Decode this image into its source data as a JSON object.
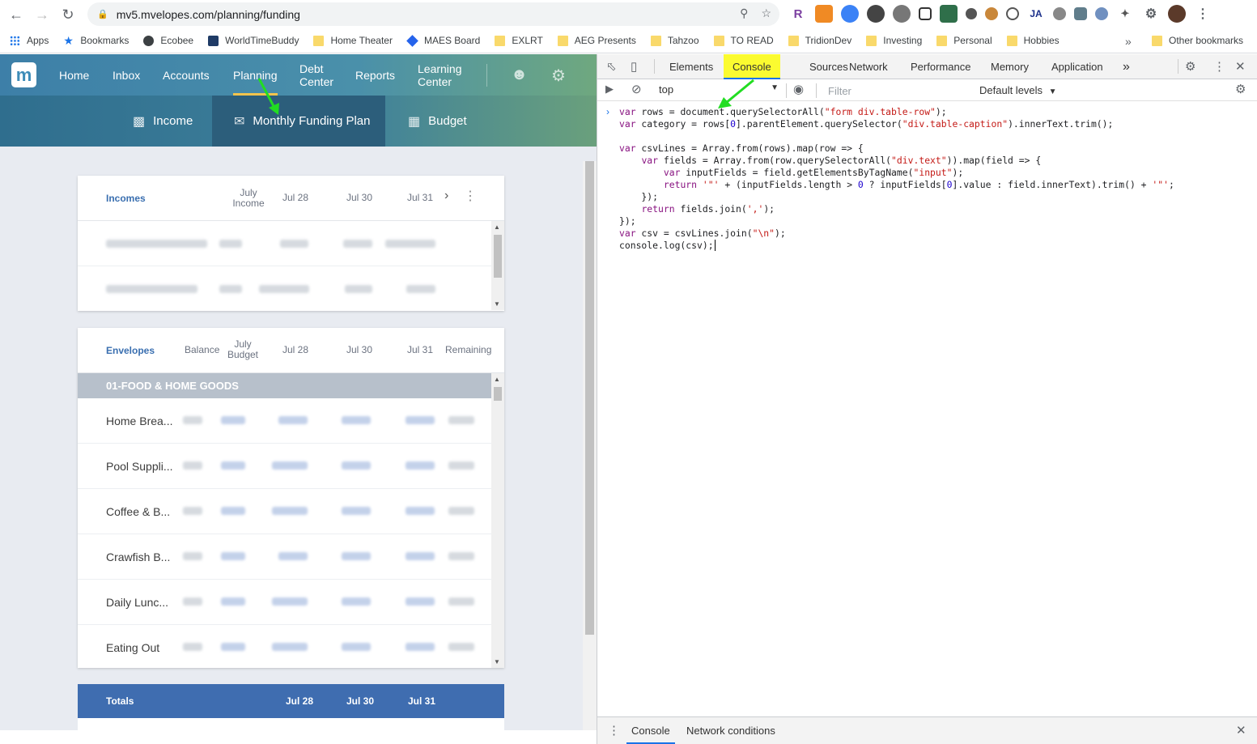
{
  "browser": {
    "url": "mv5.mvelopes.com/planning/funding",
    "bookmarks": [
      {
        "label": "Apps",
        "icon": "apps-grid-icon"
      },
      {
        "label": "Bookmarks",
        "icon": "star-icon"
      },
      {
        "label": "Ecobee",
        "icon": "globe-icon"
      },
      {
        "label": "WorldTimeBuddy",
        "icon": "clock-icon"
      },
      {
        "label": "Home Theater",
        "icon": "folder-icon"
      },
      {
        "label": "MAES Board",
        "icon": "diamond-icon"
      },
      {
        "label": "EXLRT",
        "icon": "folder-icon"
      },
      {
        "label": "AEG Presents",
        "icon": "folder-icon"
      },
      {
        "label": "Tahzoo",
        "icon": "folder-icon"
      },
      {
        "label": "TO READ",
        "icon": "folder-icon"
      },
      {
        "label": "TridionDev",
        "icon": "folder-icon"
      },
      {
        "label": "Investing",
        "icon": "folder-icon"
      },
      {
        "label": "Personal",
        "icon": "folder-icon"
      },
      {
        "label": "Hobbies",
        "icon": "folder-icon"
      }
    ],
    "more": "»",
    "other_bookmarks": "Other bookmarks"
  },
  "app": {
    "logo": "m",
    "nav": [
      {
        "label": "Home"
      },
      {
        "label": "Inbox"
      },
      {
        "label": "Accounts"
      },
      {
        "label": "Planning"
      },
      {
        "label": "Debt Center"
      },
      {
        "label": "Reports"
      },
      {
        "label": "Learning Center"
      }
    ],
    "sub_nav": [
      {
        "label": "Income"
      },
      {
        "label": "Monthly Funding Plan"
      },
      {
        "label": "Budget"
      }
    ],
    "incomes": {
      "title": "Incomes",
      "columns": [
        "July Income",
        "Jul 28",
        "Jul 30",
        "Jul 31"
      ],
      "rows": 2
    },
    "envelopes": {
      "title": "Envelopes",
      "columns": [
        "Balance",
        "July Budget",
        "Jul 28",
        "Jul 30",
        "Jul 31",
        "Remaining"
      ],
      "group": "01-FOOD & HOME GOODS",
      "rows": [
        "Home Brea...",
        "Pool Suppli...",
        "Coffee & B...",
        "Crawfish B...",
        "Daily Lunc...",
        "Eating Out"
      ]
    },
    "totals": {
      "title": "Totals",
      "columns": [
        "Jul 28",
        "Jul 30",
        "Jul 31"
      ]
    }
  },
  "devtools": {
    "tabs": [
      "Elements",
      "Console",
      "Sources",
      "Network",
      "Performance",
      "Memory",
      "Application"
    ],
    "more_tabs": "»",
    "context": "top",
    "filter_placeholder": "Filter",
    "levels": "Default levels",
    "drawer_tabs": [
      "Console",
      "Network conditions"
    ]
  }
}
